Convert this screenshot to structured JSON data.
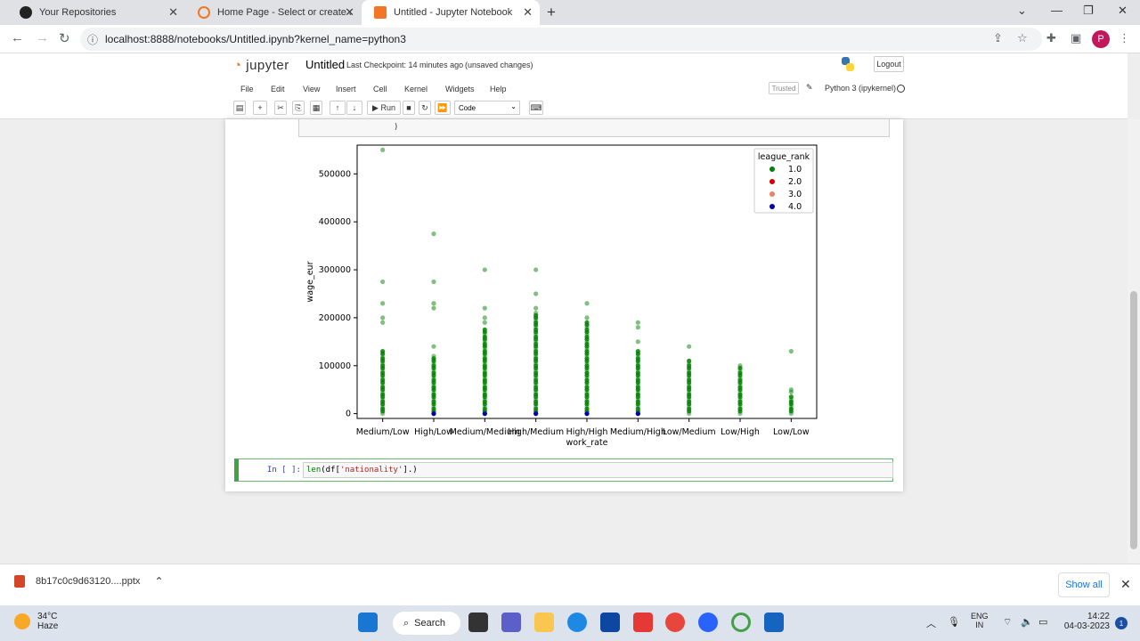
{
  "browser": {
    "tabs": [
      {
        "title": "Your Repositories",
        "active": false
      },
      {
        "title": "Home Page - Select or create a n",
        "active": false
      },
      {
        "title": "Untitled - Jupyter Notebook",
        "active": true
      }
    ],
    "url": "localhost:8888/notebooks/Untitled.ipynb?kernel_name=python3",
    "profile_initial": "P"
  },
  "jupyter": {
    "logo_text": "jupyter",
    "notebook_title": "Untitled",
    "checkpoint": "Last Checkpoint: 14 minutes ago",
    "unsaved": "(unsaved changes)",
    "logout_label": "Logout",
    "menu": [
      "File",
      "Edit",
      "View",
      "Insert",
      "Cell",
      "Kernel",
      "Widgets",
      "Help"
    ],
    "trusted_label": "Trusted",
    "kernel_name": "Python 3 (ipykernel)",
    "run_label": "Run",
    "cell_type": "Code",
    "prev_cell_tail": ")",
    "prompt": "In [ ]:",
    "code": {
      "fn": "len",
      "pre": "(df[",
      "str": "'nationality'",
      "post": "].)"
    }
  },
  "chart_data": {
    "type": "scatter",
    "xlabel": "work_rate",
    "ylabel": "wage_eur",
    "categories": [
      "Medium/Low",
      "High/Low",
      "Medium/Medium",
      "High/Medium",
      "High/High",
      "Medium/High",
      "Low/Medium",
      "Low/High",
      "Low/Low"
    ],
    "yticks": [
      0,
      100000,
      200000,
      300000,
      400000,
      500000
    ],
    "ylim": [
      -10000,
      560000
    ],
    "legend": {
      "title": "league_rank",
      "placement": "top-right",
      "entries": [
        "1.0",
        "2.0",
        "3.0",
        "4.0"
      ]
    },
    "colors": {
      "1.0": "#008000",
      "2.0": "#d00000",
      "3.0": "#f08060",
      "4.0": "#0000aa"
    },
    "outliers": [
      {
        "category": "Medium/Low",
        "values": [
          550000,
          275000,
          230000,
          200000,
          190000
        ]
      },
      {
        "category": "High/Low",
        "values": [
          375000,
          275000,
          230000,
          220000,
          140000
        ]
      },
      {
        "category": "Medium/Medium",
        "values": [
          300000,
          220000,
          200000,
          190000
        ]
      },
      {
        "category": "High/Medium",
        "values": [
          300000,
          250000,
          220000
        ]
      },
      {
        "category": "High/High",
        "values": [
          230000,
          200000
        ]
      },
      {
        "category": "Medium/High",
        "values": [
          190000,
          180000,
          150000
        ]
      },
      {
        "category": "Low/Medium",
        "values": [
          140000
        ]
      },
      {
        "category": "Low/High",
        "values": [
          100000
        ]
      },
      {
        "category": "Low/Low",
        "values": [
          130000,
          50000,
          45000
        ]
      }
    ],
    "dense_max": [
      130000,
      120000,
      175000,
      210000,
      190000,
      130000,
      110000,
      95000,
      35000
    ],
    "rank4_categories": [
      "High/Low",
      "Medium/Medium",
      "High/Medium",
      "High/High",
      "Medium/High"
    ]
  },
  "downloads": {
    "file": "8b17c0c9d63120....pptx",
    "show_all": "Show all"
  },
  "taskbar": {
    "temp": "34°C",
    "weather": "Haze",
    "search": "Search",
    "lang1": "ENG",
    "lang2": "IN",
    "time": "14:22",
    "date": "04-03-2023",
    "notif_count": "1"
  }
}
